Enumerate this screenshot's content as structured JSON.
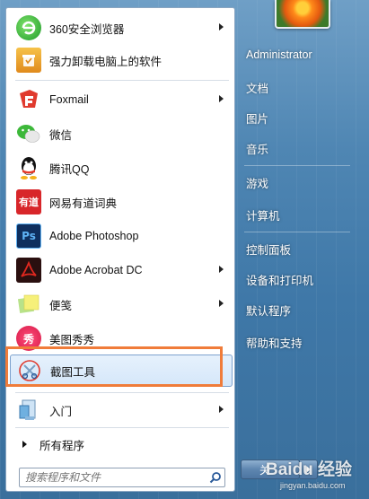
{
  "programs": [
    {
      "label": "360安全浏览器",
      "icon": "360-browser-icon",
      "arrow": true
    },
    {
      "label": "强力卸载电脑上的软件",
      "icon": "uninstall-icon",
      "arrow": false
    },
    {
      "label": "Foxmail",
      "icon": "foxmail-icon",
      "arrow": true
    },
    {
      "label": "微信",
      "icon": "wechat-icon",
      "arrow": false
    },
    {
      "label": "腾讯QQ",
      "icon": "qq-icon",
      "arrow": false
    },
    {
      "label": "网易有道词典",
      "icon": "youdao-icon",
      "arrow": false
    },
    {
      "label": "Adobe Photoshop",
      "icon": "photoshop-icon",
      "arrow": false
    },
    {
      "label": "Adobe Acrobat DC",
      "icon": "acrobat-icon",
      "arrow": true
    },
    {
      "label": "便笺",
      "icon": "sticky-notes-icon",
      "arrow": true
    },
    {
      "label": "美图秀秀",
      "icon": "meitu-icon",
      "arrow": false
    },
    {
      "label": "截图工具",
      "icon": "snipping-tool-icon",
      "arrow": false
    },
    {
      "label": "入门",
      "icon": "getting-started-icon",
      "arrow": true
    }
  ],
  "icon_text": {
    "youdao": "有道",
    "photoshop": "Ps",
    "meitu": "秀"
  },
  "all_programs_label": "所有程序",
  "search": {
    "placeholder": "搜索程序和文件"
  },
  "right": {
    "user": "Administrator",
    "documents": "文档",
    "pictures": "图片",
    "music": "音乐",
    "games": "游戏",
    "computer": "计算机",
    "control_panel": "控制面板",
    "devices_printers": "设备和打印机",
    "default_programs": "默认程序",
    "help_support": "帮助和支持"
  },
  "shutdown_label": "关",
  "watermark": {
    "brand": "Baidu 经验",
    "url": "jingyan.baidu.com"
  },
  "colors": {
    "highlight": "#f07c3a",
    "selection": "#d5e7fa"
  }
}
